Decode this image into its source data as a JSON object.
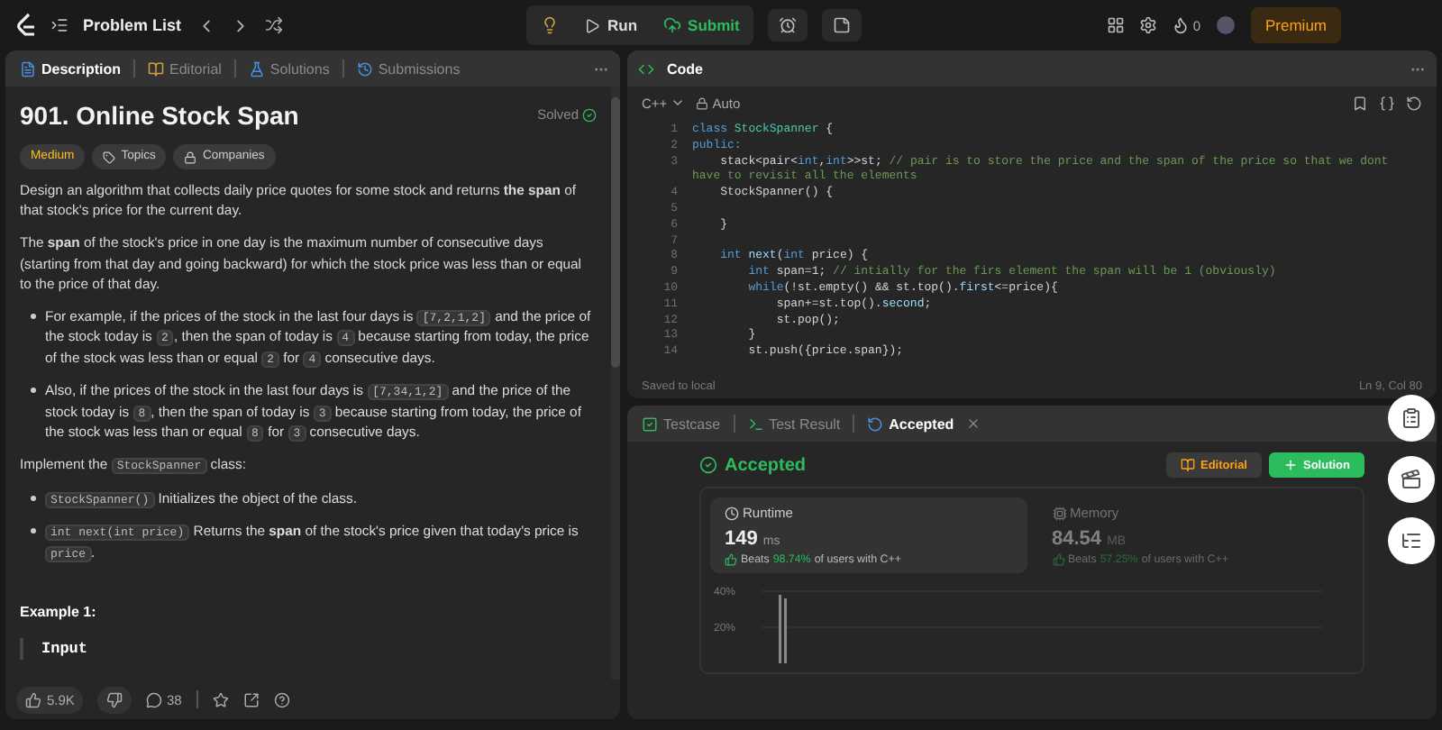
{
  "topbar": {
    "problem_list": "Problem List",
    "run": "Run",
    "submit": "Submit",
    "streak": "0",
    "premium": "Premium"
  },
  "left_tabs": [
    {
      "label": "Description",
      "selected": true
    },
    {
      "label": "Editorial",
      "selected": false
    },
    {
      "label": "Solutions",
      "selected": false
    },
    {
      "label": "Submissions",
      "selected": false
    }
  ],
  "problem": {
    "title": "901. Online Stock Span",
    "status": "Solved",
    "difficulty": "Medium",
    "tags": [
      "Topics",
      "Companies"
    ],
    "content": [
      {
        "kind": "p",
        "parts": [
          {
            "kind": "text",
            "t": "Design an algorithm that collects daily price quotes for some stock and returns **the span** of that stock's price for the current day."
          }
        ]
      },
      {
        "kind": "p",
        "parts": [
          {
            "kind": "text",
            "t": "The **span** of the stock's price in one day is the maximum number of consecutive days (starting from that day and going backward) for which the stock price was less than or equal to the price of that day."
          }
        ]
      },
      {
        "kind": "li",
        "parts": [
          {
            "kind": "text",
            "t": "For example, if the prices of the stock in the last four days is "
          },
          {
            "kind": "code",
            "t": "[7,2,1,2]"
          },
          {
            "kind": "text",
            "t": " and the price of the stock today is "
          },
          {
            "kind": "code",
            "t": "2"
          },
          {
            "kind": "text",
            "t": ", then the span of today is "
          },
          {
            "kind": "code",
            "t": "4"
          },
          {
            "kind": "text",
            "t": " because starting from today, the price of the stock was less than or equal "
          },
          {
            "kind": "code",
            "t": "2"
          },
          {
            "kind": "text",
            "t": " for "
          },
          {
            "kind": "code",
            "t": "4"
          },
          {
            "kind": "text",
            "t": " consecutive days."
          }
        ]
      },
      {
        "kind": "li",
        "parts": [
          {
            "kind": "text",
            "t": "Also, if the prices of the stock in the last four days is "
          },
          {
            "kind": "code",
            "t": "[7,34,1,2]"
          },
          {
            "kind": "text",
            "t": " and the price of the stock today is "
          },
          {
            "kind": "code",
            "t": "8"
          },
          {
            "kind": "text",
            "t": ", then the span of today is "
          },
          {
            "kind": "code",
            "t": "3"
          },
          {
            "kind": "text",
            "t": " because starting from today, the price of the stock was less than or equal "
          },
          {
            "kind": "code",
            "t": "8"
          },
          {
            "kind": "text",
            "t": " for "
          },
          {
            "kind": "code",
            "t": "3"
          },
          {
            "kind": "text",
            "t": " consecutive days."
          }
        ]
      },
      {
        "kind": "p",
        "parts": [
          {
            "kind": "text",
            "t": "Implement the "
          },
          {
            "kind": "code",
            "t": "StockSpanner"
          },
          {
            "kind": "text",
            "t": " class:"
          }
        ]
      },
      {
        "kind": "li",
        "parts": [
          {
            "kind": "code",
            "t": "StockSpanner()"
          },
          {
            "kind": "text",
            "t": " Initializes the object of the class."
          }
        ]
      },
      {
        "kind": "li",
        "parts": [
          {
            "kind": "code",
            "t": "int next(int price)"
          },
          {
            "kind": "text",
            "t": " Returns the **span** of the stock's price given that today's price is "
          },
          {
            "kind": "code",
            "t": "price"
          },
          {
            "kind": "text",
            "t": "."
          }
        ]
      },
      {
        "kind": "heading",
        "text": "Example 1:"
      },
      {
        "kind": "example",
        "text": "Input"
      }
    ]
  },
  "footer": {
    "likes": "5.9K",
    "comments": "38"
  },
  "code_panel": {
    "title": "Code",
    "language": "C++",
    "mode": "Auto",
    "status": "Saved to local",
    "cursor": "Ln 9, Col 80",
    "lines": [
      {
        "n": "1",
        "tokens": [
          {
            "kind": "kw",
            "t": "class "
          },
          {
            "kind": "cls",
            "t": "StockSpanner"
          },
          {
            "kind": "p",
            "t": " {"
          }
        ]
      },
      {
        "n": "2",
        "tokens": [
          {
            "kind": "kw",
            "t": "public:"
          }
        ]
      },
      {
        "n": "3",
        "tokens": [
          {
            "kind": "p",
            "t": "    stack<pair<"
          },
          {
            "kind": "kw",
            "t": "int"
          },
          {
            "kind": "p",
            "t": ","
          },
          {
            "kind": "kw",
            "t": "int"
          },
          {
            "kind": "p",
            "t": ">>st; "
          },
          {
            "kind": "cm",
            "t": "// pair is to store the price and the span of the price so that we dont have to revisit all the elements"
          }
        ]
      },
      {
        "n": "4",
        "tokens": [
          {
            "kind": "p",
            "t": "    StockSpanner() {"
          }
        ]
      },
      {
        "n": "5"
      },
      {
        "n": "6",
        "tokens": [
          {
            "kind": "p",
            "t": "    }"
          }
        ]
      },
      {
        "n": "7"
      },
      {
        "n": "8",
        "tokens": [
          {
            "kind": "kw",
            "t": "    int "
          },
          {
            "kind": "fn",
            "t": "next"
          },
          {
            "kind": "p",
            "t": "("
          },
          {
            "kind": "kw",
            "t": "int"
          },
          {
            "kind": "p",
            "t": " price) {"
          }
        ]
      },
      {
        "n": "9",
        "tokens": [
          {
            "kind": "kw",
            "t": "        int "
          },
          {
            "kind": "p",
            "t": "span=1; "
          },
          {
            "kind": "cm",
            "t": "// intially for the firs element the span will be 1 (obviously)"
          }
        ]
      },
      {
        "n": "10",
        "tokens": [
          {
            "kind": "kw",
            "t": "        while"
          },
          {
            "kind": "p",
            "t": "(!st.empty() && st.top()."
          },
          {
            "kind": "fn",
            "t": "first"
          },
          {
            "kind": "p",
            "t": "<=price){"
          }
        ]
      },
      {
        "n": "11",
        "tokens": [
          {
            "kind": "p",
            "t": "            span+=st.top()."
          },
          {
            "kind": "fn",
            "t": "second"
          },
          {
            "kind": "p",
            "t": ";"
          }
        ]
      },
      {
        "n": "12",
        "tokens": [
          {
            "kind": "p",
            "t": "            st.pop();"
          }
        ]
      },
      {
        "n": "13",
        "tokens": [
          {
            "kind": "p",
            "t": "        }"
          }
        ]
      },
      {
        "n": "14",
        "tokens": [
          {
            "kind": "p",
            "t": "        st.push({price.span});"
          }
        ]
      }
    ]
  },
  "result_tabs": [
    {
      "label": "Testcase",
      "selected": false
    },
    {
      "label": "Test Result",
      "selected": false
    },
    {
      "label": "Accepted",
      "selected": true
    }
  ],
  "result": {
    "verdict": "Accepted",
    "editorial_button": "Editorial",
    "solution_button": "Solution",
    "metrics": [
      {
        "label": "Runtime",
        "value": "149",
        "unit": "ms",
        "beats_prefix": "Beats",
        "beats": "98.74%",
        "beats_suffix": "of users with C++",
        "selected": true
      },
      {
        "label": "Memory",
        "value": "84.54",
        "unit": "MB",
        "beats_prefix": "Beats",
        "beats": "57.25%",
        "beats_suffix": "of users with C++",
        "selected": false
      }
    ],
    "histogram": {
      "axis_labels": [
        "40%",
        "20%"
      ]
    }
  }
}
